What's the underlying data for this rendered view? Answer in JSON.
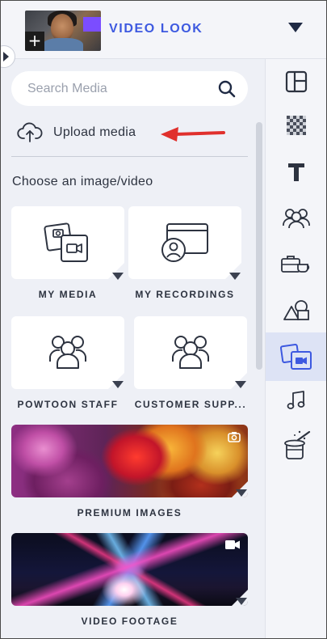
{
  "header": {
    "title": "VIDEO LOOK",
    "thumbnail_plus": "+"
  },
  "search": {
    "placeholder": "Search Media"
  },
  "upload": {
    "label": "Upload media"
  },
  "section": {
    "heading": "Choose an image/video"
  },
  "tiles": [
    {
      "label": "MY MEDIA",
      "icon": "my-media-icon"
    },
    {
      "label": "MY RECORDINGS",
      "icon": "recordings-icon"
    },
    {
      "label": "POWTOON STAFF",
      "icon": "people-icon"
    },
    {
      "label": "CUSTOMER SUPP...",
      "icon": "people-icon"
    },
    {
      "label": "PREMIUM IMAGES",
      "icon": "camera-icon"
    },
    {
      "label": "VIDEO FOOTAGE",
      "icon": "video-camera-icon"
    }
  ],
  "rail": [
    {
      "name": "layouts-icon"
    },
    {
      "name": "backgrounds-icon"
    },
    {
      "name": "text-icon"
    },
    {
      "name": "characters-icon"
    },
    {
      "name": "props-icon"
    },
    {
      "name": "shapes-icon"
    },
    {
      "name": "media-icon",
      "active": true
    },
    {
      "name": "music-icon"
    },
    {
      "name": "specials-icon"
    }
  ],
  "colors": {
    "accent": "#3d59e0",
    "panel": "#eef0f6",
    "arrow": "#e0302c",
    "active_rail": "#dde3f5"
  }
}
